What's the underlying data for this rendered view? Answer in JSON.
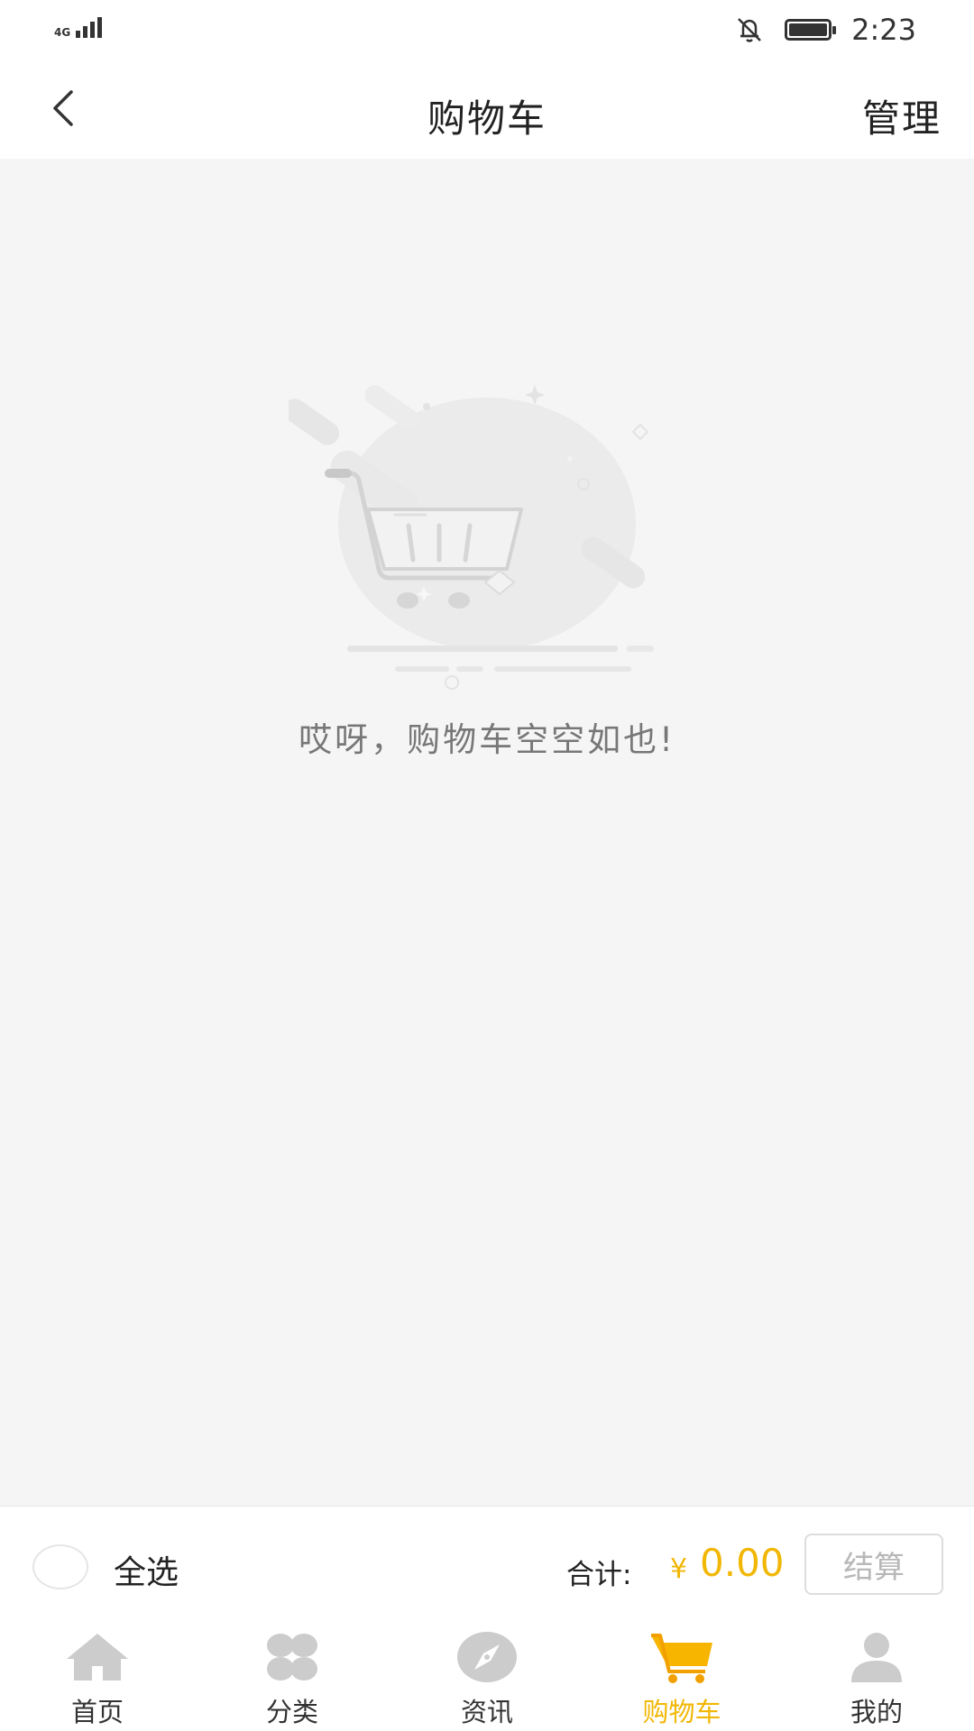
{
  "status_bar": {
    "network": "4G",
    "time": "2:23",
    "icons": [
      "signal-icon",
      "mute-bell-icon",
      "battery-icon"
    ]
  },
  "header": {
    "title": "购物车",
    "manage_label": "管理",
    "back_icon": "chevron-left-icon"
  },
  "empty_state": {
    "message": "哎呀，购物车空空如也!",
    "illustration": "empty-cart-icon"
  },
  "cart_bar": {
    "select_all_label": "全选",
    "total_label": "合计:",
    "currency": "¥",
    "total_amount": "0.00",
    "checkout_label": "结算"
  },
  "tabs": [
    {
      "label": "首页",
      "icon": "home-icon",
      "active": false
    },
    {
      "label": "分类",
      "icon": "category-icon",
      "active": false
    },
    {
      "label": "资讯",
      "icon": "compass-icon",
      "active": false
    },
    {
      "label": "购物车",
      "icon": "cart-icon",
      "active": true
    },
    {
      "label": "我的",
      "icon": "user-icon",
      "active": false
    }
  ],
  "colors": {
    "accent": "#f2b705",
    "background": "#f5f5f5",
    "inactive_icon": "#cccccc"
  }
}
